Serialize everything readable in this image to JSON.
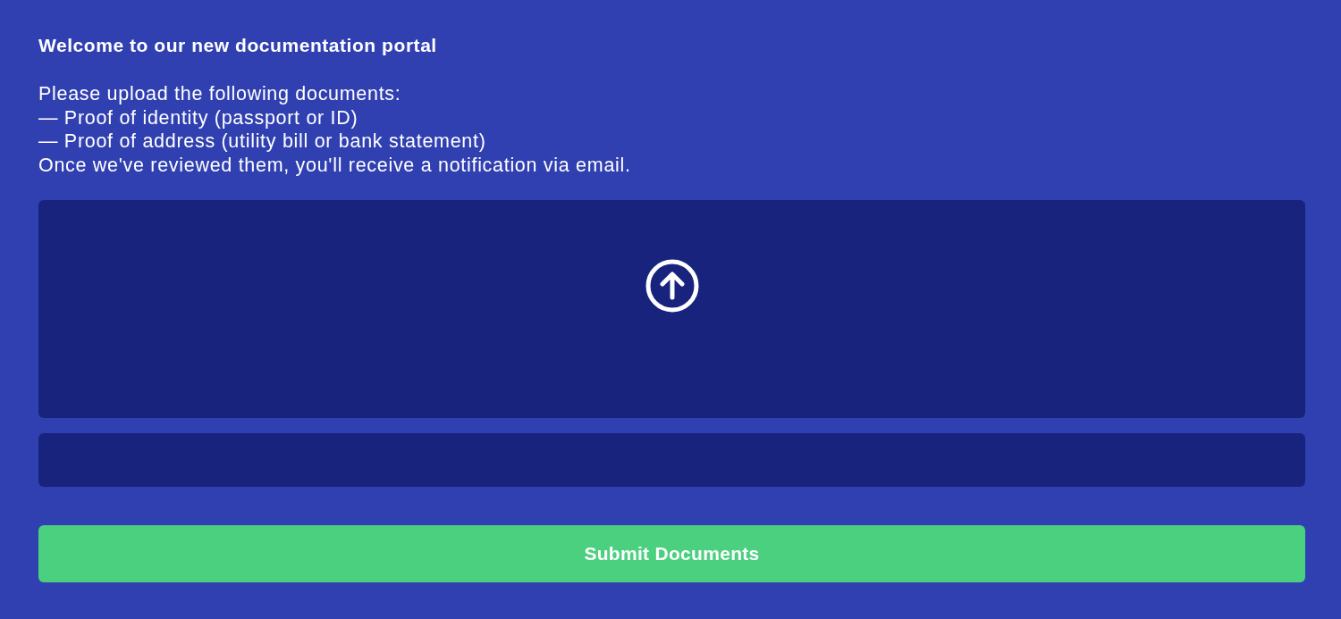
{
  "heading": "Welcome to our new documentation portal",
  "instructions": {
    "lead": "Please upload the following documents:",
    "items": [
      "— Proof of identity (passport or ID)",
      "— Proof of address (utility bill or bank statement)"
    ],
    "note": "Once we've reviewed them, you'll receive a notification via email."
  },
  "upload_area": {
    "kind": "dropzone"
  },
  "text_field": {
    "kind": "input"
  },
  "submit_button": {
    "label": "Submit Documents"
  }
}
